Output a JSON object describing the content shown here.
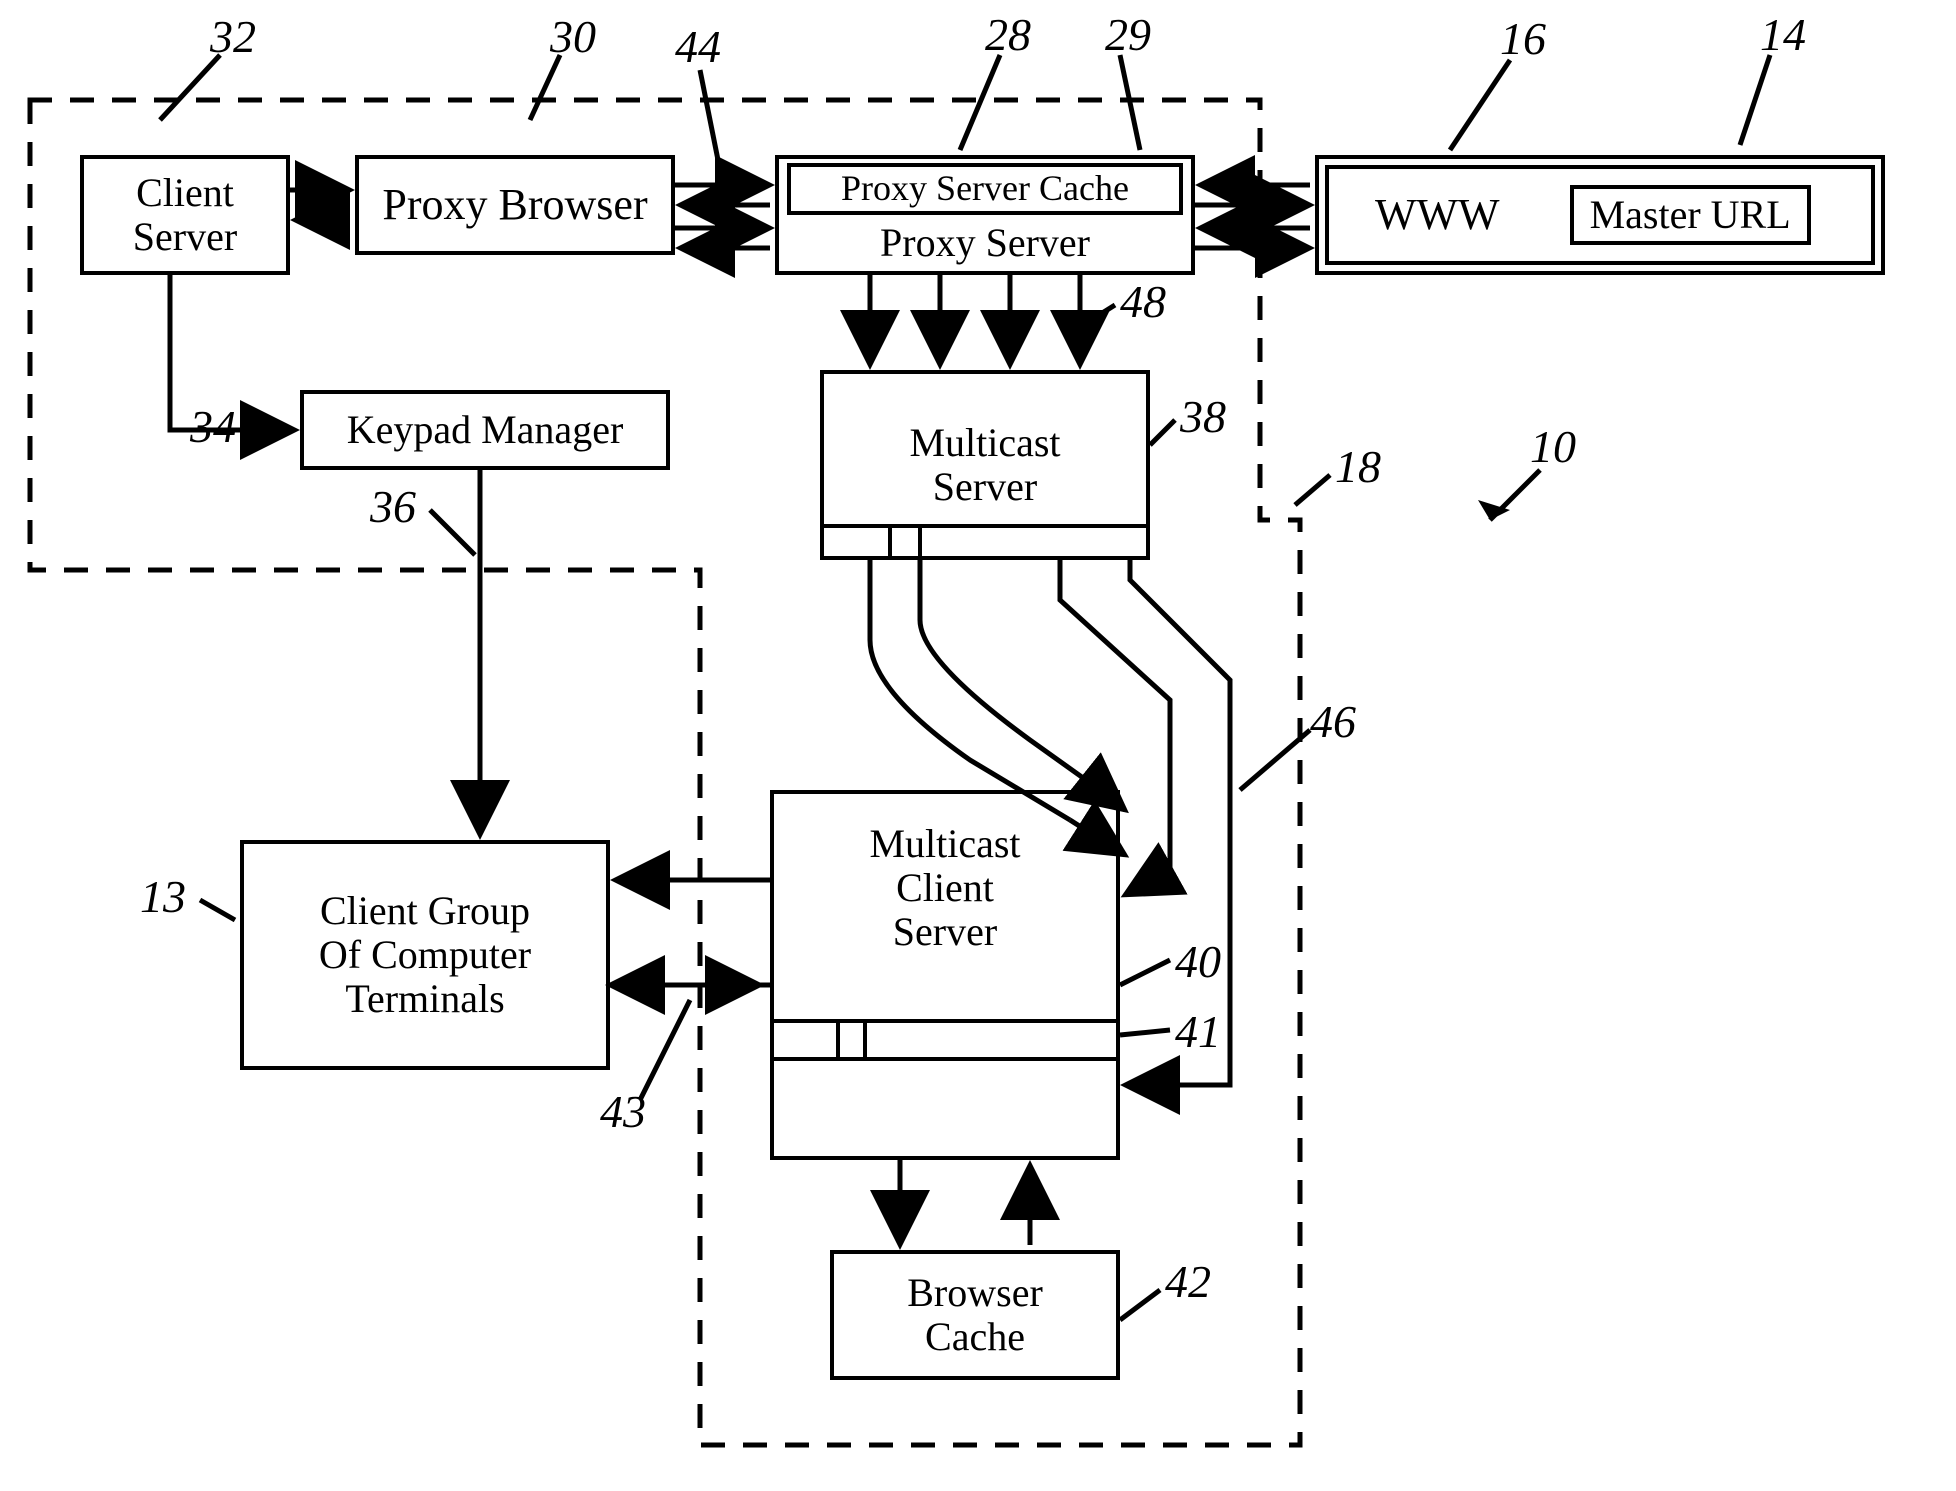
{
  "boxes": {
    "client_server": "Client\nServer",
    "proxy_browser": "Proxy Browser",
    "proxy_server_cache": "Proxy Server Cache",
    "proxy_server": "Proxy Server",
    "www": "WWW",
    "master_url": "Master URL",
    "keypad_manager": "Keypad Manager",
    "multicast_server": "Multicast\nServer",
    "client_group": "Client Group\nOf Computer\nTerminals",
    "multicast_client_server": "Multicast\nClient\nServer",
    "browser_cache": "Browser\nCache"
  },
  "refs": {
    "n10": "10",
    "n13": "13",
    "n14": "14",
    "n16": "16",
    "n18": "18",
    "n28": "28",
    "n29": "29",
    "n30": "30",
    "n32": "32",
    "n34": "34",
    "n36": "36",
    "n38": "38",
    "n40": "40",
    "n41": "41",
    "n42": "42",
    "n43": "43",
    "n44": "44",
    "n46": "46",
    "n48": "48"
  }
}
